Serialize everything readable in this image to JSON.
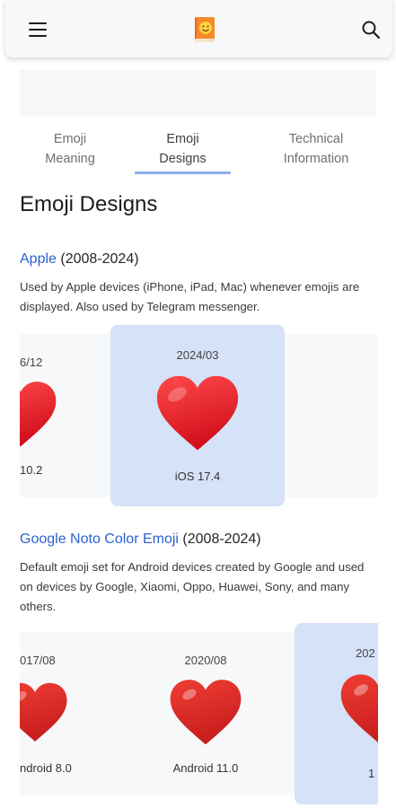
{
  "header": {
    "menu_icon": "hamburger-menu-icon",
    "logo_icon": "emojipedia-book-logo",
    "search_icon": "search-icon"
  },
  "tabs": [
    {
      "label": "Emoji\nMeaning",
      "active": false
    },
    {
      "label": "Emoji\nDesigns",
      "active": true
    },
    {
      "label": "Technical\nInformation",
      "active": false
    }
  ],
  "page_title": "Emoji Designs",
  "sections": [
    {
      "vendor": "Apple",
      "years": " (2008-2024)",
      "description": "Used by Apple devices (iPhone, iPad, Mac) whenever emojis are displayed. Also used by Telegram messenger.",
      "cards": [
        {
          "date": "6/12",
          "version": "10.2"
        },
        {
          "date": "2024/03",
          "version": "iOS 17.4",
          "selected": true
        }
      ]
    },
    {
      "vendor": "Google Noto Color Emoji",
      "years": " (2008-2024)",
      "description": "Default emoji set for Android devices created by Google and used on devices by Google, Xiaomi, Oppo, Huawei, Sony, and many others.",
      "cards": [
        {
          "date": "017/08",
          "version": "ndroid 8.0"
        },
        {
          "date": "2020/08",
          "version": "Android 11.0"
        },
        {
          "date": "202",
          "version": "1",
          "selected": true
        }
      ]
    }
  ],
  "colors": {
    "link": "#2a62cf",
    "selected_card": "#d6e2f7",
    "tab_underline": "#8fb0ec",
    "heart_red": "#e8202c"
  }
}
